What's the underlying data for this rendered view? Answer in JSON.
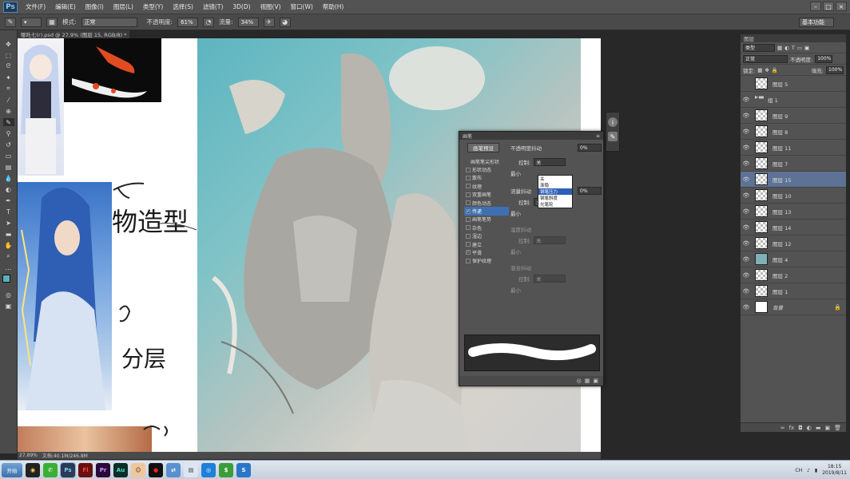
{
  "menubar": {
    "logo": "Ps",
    "items": [
      "文件(F)",
      "编辑(E)",
      "图像(I)",
      "图层(L)",
      "类型(Y)",
      "选择(S)",
      "滤镜(T)",
      "3D(D)",
      "视图(V)",
      "窗口(W)",
      "帮助(H)"
    ]
  },
  "options": {
    "mode_label": "模式:",
    "mode_value": "正常",
    "opacity_label": "不透明度:",
    "opacity_value": "61%",
    "flow_label": "流量:",
    "flow_value": "34%",
    "workspace": "基本功能"
  },
  "document": {
    "tab_title": "哪吒七(r).psd @ 27.9% (图层 15, RGB/8) *"
  },
  "canvas": {
    "annotations": [
      "物造型",
      "分层"
    ]
  },
  "brush_panel": {
    "title": "画笔",
    "preset_button": "画笔预设",
    "tip_header": "画笔笔尖形状",
    "options": [
      {
        "label": "形状动态",
        "checked": false
      },
      {
        "label": "散布",
        "checked": false
      },
      {
        "label": "纹理",
        "checked": false
      },
      {
        "label": "双重画笔",
        "checked": false
      },
      {
        "label": "颜色动态",
        "checked": false
      },
      {
        "label": "传递",
        "checked": true,
        "selected": true
      },
      {
        "label": "画笔笔势",
        "checked": false
      },
      {
        "label": "杂色",
        "checked": false
      },
      {
        "label": "湿边",
        "checked": false
      },
      {
        "label": "建立",
        "checked": false
      },
      {
        "label": "平滑",
        "checked": true
      },
      {
        "label": "保护纹理",
        "checked": false
      }
    ],
    "opacity_jitter_label": "不透明度抖动",
    "opacity_jitter_value": "0%",
    "control_label": "控制:",
    "control_value": "关",
    "dropdown_options": [
      "关",
      "渐隐",
      "钢笔压力",
      "钢笔斜度",
      "光笔轮"
    ],
    "dropdown_highlight": 2,
    "min_label": "最小",
    "flow_jitter_label": "流量抖动",
    "flow_jitter_value": "0%",
    "control2_value": "关",
    "wetness_label": "湿度抖动",
    "mix_label": "混合抖动",
    "control3_value": "关",
    "control4_value": "关"
  },
  "layers_panel": {
    "title": "图层",
    "search_kind": "类型",
    "blend_mode": "正常",
    "opacity_label": "不透明度:",
    "opacity_value": "100%",
    "lock_label": "锁定:",
    "fill_label": "填充:",
    "fill_value": "100%",
    "layers": [
      {
        "name": "图层 5",
        "visible": false,
        "type": "layer"
      },
      {
        "name": "组 1",
        "visible": true,
        "type": "group"
      },
      {
        "name": "图层 9",
        "visible": true,
        "type": "layer"
      },
      {
        "name": "图层 8",
        "visible": true,
        "type": "layer"
      },
      {
        "name": "图层 11",
        "visible": true,
        "type": "layer"
      },
      {
        "name": "图层 7",
        "visible": true,
        "type": "layer"
      },
      {
        "name": "图层 15",
        "visible": true,
        "type": "layer",
        "selected": true
      },
      {
        "name": "图层 10",
        "visible": true,
        "type": "layer"
      },
      {
        "name": "图层 13",
        "visible": true,
        "type": "layer"
      },
      {
        "name": "图层 14",
        "visible": true,
        "type": "layer"
      },
      {
        "name": "图层 12",
        "visible": true,
        "type": "layer"
      },
      {
        "name": "图层 4",
        "visible": true,
        "type": "layer"
      },
      {
        "name": "图层 2",
        "visible": true,
        "type": "layer"
      },
      {
        "name": "图层 1",
        "visible": true,
        "type": "layer"
      },
      {
        "name": "背景",
        "visible": true,
        "type": "background",
        "locked": true
      }
    ]
  },
  "statusbar": {
    "zoom": "27.89%",
    "doc_size": "文档:40.1M/246.8M"
  },
  "taskbar": {
    "start": "开始",
    "apps": [
      "QQ",
      "WeChat",
      "Ps",
      "Fl",
      "Pr",
      "Au"
    ],
    "time": "18:15",
    "date": "2019/8/11"
  },
  "colors": {
    "accent": "#3e6fb0",
    "foreground_swatch": "#5ab0bd",
    "background_swatch": "#d9d9d9"
  }
}
